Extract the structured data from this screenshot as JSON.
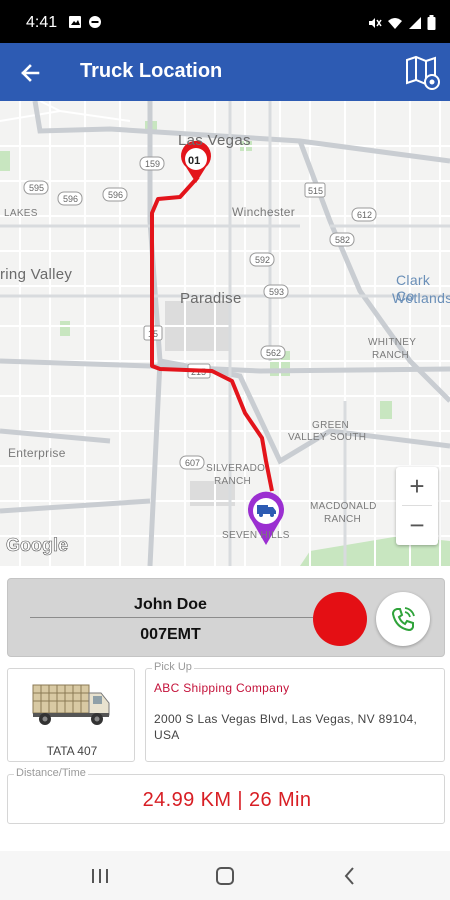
{
  "status_bar": {
    "time": "4:41",
    "left_icons": [
      "image-icon",
      "minus-circle-icon"
    ],
    "right_icons": [
      "mute-icon",
      "wifi-icon",
      "signal-icon",
      "battery-icon"
    ]
  },
  "app_bar": {
    "title": "Truck Location",
    "background": "#2d5bb3",
    "back_icon": "arrow-left-icon",
    "map_icon": "map-settings-icon"
  },
  "map": {
    "labels": {
      "las_vegas": "Las Vegas",
      "winchester": "Winchester",
      "spring_valley": "ring Valley",
      "paradise": "Paradise",
      "clark_co": "Clark Co",
      "wetlands": "Wetlands",
      "whitney": "WHITNEY",
      "ranch1": "RANCH",
      "enterprise": "Enterprise",
      "green_valley": "GREEN",
      "valley_south": "VALLEY SOUTH",
      "silverado": "SILVERADO",
      "silverado_ranch": "RANCH",
      "macdonald": "MACDONALD",
      "macdonald_ranch": "RANCH",
      "seven_hills": "SEVEN HILLS",
      "lakes": "LAKES",
      "road_159": "159",
      "road_595": "595",
      "road_596": "596",
      "road_592": "592",
      "road_515": "515",
      "road_612": "612",
      "road_582": "582",
      "road_593": "593",
      "road_15": "15",
      "road_215": "215",
      "road_562": "562",
      "road_607": "607"
    },
    "start_marker_label": "01",
    "route_color": "#e3141b",
    "zoom_in": "+",
    "zoom_out": "−",
    "attribution": "Google"
  },
  "driver": {
    "name": "John Doe",
    "code": "007EMT",
    "status_color": "#e40f14",
    "call_icon": "phone-icon"
  },
  "vehicle": {
    "name": "TATA 407",
    "icon": "truck-image"
  },
  "pickup": {
    "legend": "Pick Up",
    "company": "ABC Shipping Company",
    "address": "2000 S Las Vegas Blvd, Las Vegas, NV 89104, USA"
  },
  "distance": {
    "legend": "Distance/Time",
    "value": "24.99 KM | 26 Min"
  },
  "nav_bar": {
    "buttons": [
      "recent-apps-icon",
      "home-icon",
      "back-icon"
    ]
  }
}
